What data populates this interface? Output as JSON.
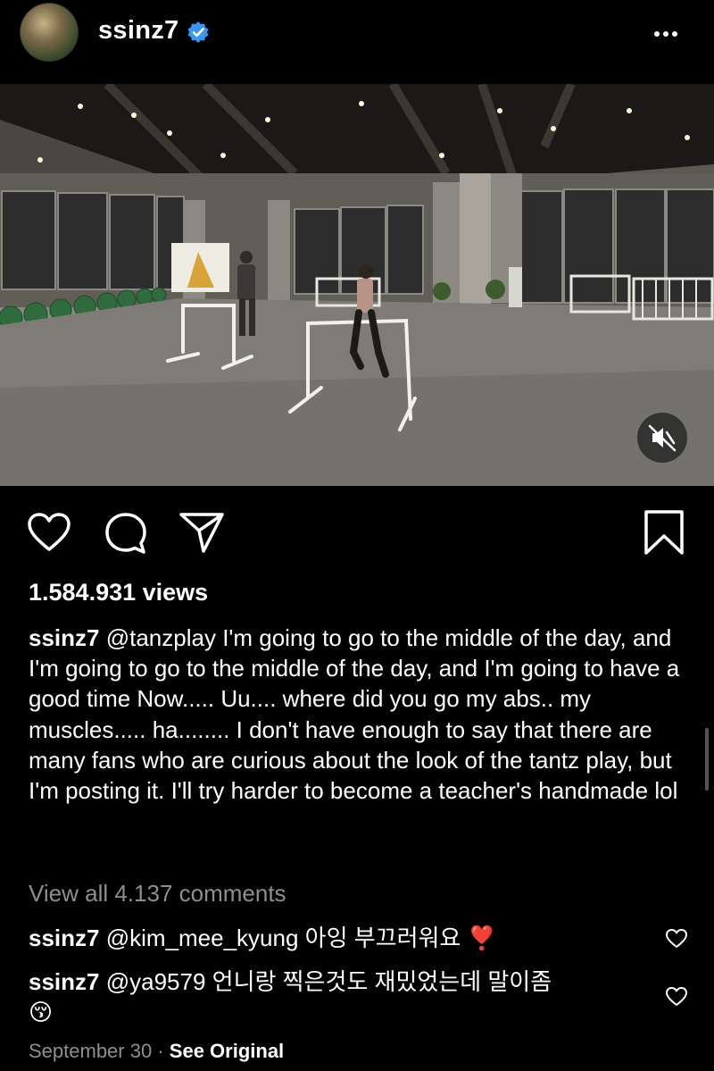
{
  "header": {
    "username": "ssinz7",
    "verified": true
  },
  "post": {
    "views": "1.584.931 views",
    "caption": {
      "username": "ssinz7",
      "text": "@tanzplay I'm going to go to the middle of the day, and I'm going to go to the middle of the day, and I'm going to have a good time Now..... Uu.... where did you go my abs.. my muscles..... ha........ I don't have enough to say that there are many fans who are curious about the look of the tantz play, but I'm posting it. I'll try harder to become a teacher's handmade lol"
    },
    "view_all_comments": "View all 4.137 comments",
    "comments": [
      {
        "username": "ssinz7",
        "text": "@kim_mee_kyung 아잉 부끄러워요 ",
        "emoji": "❣️"
      },
      {
        "username": "ssinz7",
        "text": "@ya9579 언니랑 찍은것도 재밌었는데 말이좀 ",
        "emoji": "😚"
      }
    ],
    "date": "September 30",
    "separator": "·",
    "see_original": "See Original"
  },
  "icons": {
    "verified": "verified-badge-icon",
    "more": "more-options-icon",
    "mute": "muted-speaker-icon",
    "like": "heart-icon",
    "comment": "comment-bubble-icon",
    "share": "paper-plane-icon",
    "save": "bookmark-icon"
  },
  "colors": {
    "background": "#000000",
    "text": "#ffffff",
    "secondary_text": "#8e8e8e",
    "verified_blue": "#3897f0"
  }
}
